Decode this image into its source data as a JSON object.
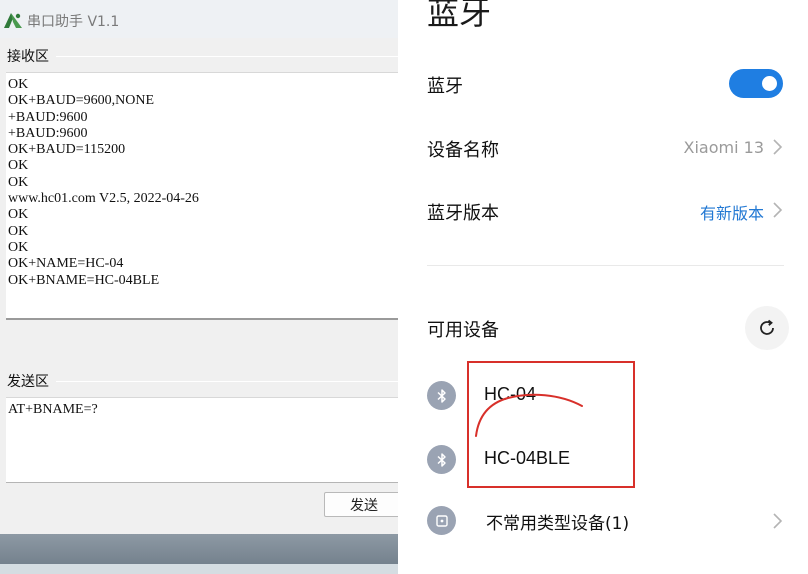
{
  "serial_app": {
    "title": "串口助手 V1.1",
    "receive_label": "接收区",
    "receive_lines": [
      "OK",
      "OK+BAUD=9600,NONE",
      "+BAUD:9600",
      "+BAUD:9600",
      "OK+BAUD=115200",
      "OK",
      "OK",
      "www.hc01.com V2.5, 2022-04-26",
      "OK",
      "OK",
      "OK",
      "OK+NAME=HC-04",
      "OK+BNAME=HC-04BLE"
    ],
    "send_label": "发送区",
    "send_value": "AT+BNAME=?",
    "send_button": "发送"
  },
  "bluetooth": {
    "page_title": "蓝牙",
    "toggle_label": "蓝牙",
    "toggle_on": true,
    "device_name_label": "设备名称",
    "device_name_value": "Xiaomi 13",
    "version_label": "蓝牙版本",
    "version_value": "有新版本",
    "available_label": "可用设备",
    "devices": [
      {
        "name": "HC-04",
        "icon": "bluetooth-icon"
      },
      {
        "name": "HC-04BLE",
        "icon": "bluetooth-icon"
      }
    ],
    "rare_devices_label": "不常用类型设备(1)",
    "colors": {
      "accent": "#1f7ee2",
      "link": "#2278d3",
      "annotation": "#d8302a",
      "device_icon_bg": "#9aa3b3"
    }
  }
}
